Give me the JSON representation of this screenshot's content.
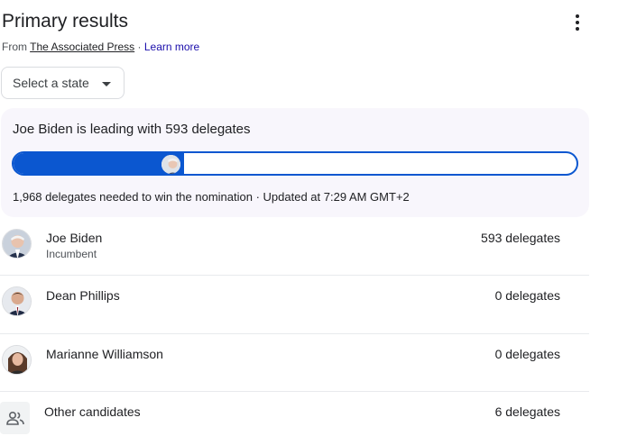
{
  "header": {
    "title": "Primary results",
    "source_prefix": "From ",
    "source_name": "The Associated Press",
    "source_sep": " · ",
    "learn_more": "Learn more"
  },
  "state_select": {
    "label": "Select a state"
  },
  "summary": {
    "leading_text": "Joe Biden is leading with 593 delegates",
    "progress_fraction": 0.303,
    "needed_text": "1,968 delegates needed to win the nomination · Updated at 7:29 AM GMT+2"
  },
  "candidates": [
    {
      "name": "Joe Biden",
      "subtitle": "Incumbent",
      "delegates": "593 delegates",
      "avatar": "joe-biden-avatar"
    },
    {
      "name": "Dean Phillips",
      "subtitle": "",
      "delegates": "0 delegates",
      "avatar": "dean-phillips-avatar"
    },
    {
      "name": "Marianne Williamson",
      "subtitle": "",
      "delegates": "0 delegates",
      "avatar": "marianne-williamson-avatar"
    },
    {
      "name": "Other candidates",
      "subtitle": "",
      "delegates": "6 delegates",
      "avatar": "people-icon"
    }
  ],
  "colors": {
    "accent": "#0b57d0",
    "card_bg": "#f8f6fc",
    "divider": "#e8eaed",
    "link": "#1a0dab"
  }
}
